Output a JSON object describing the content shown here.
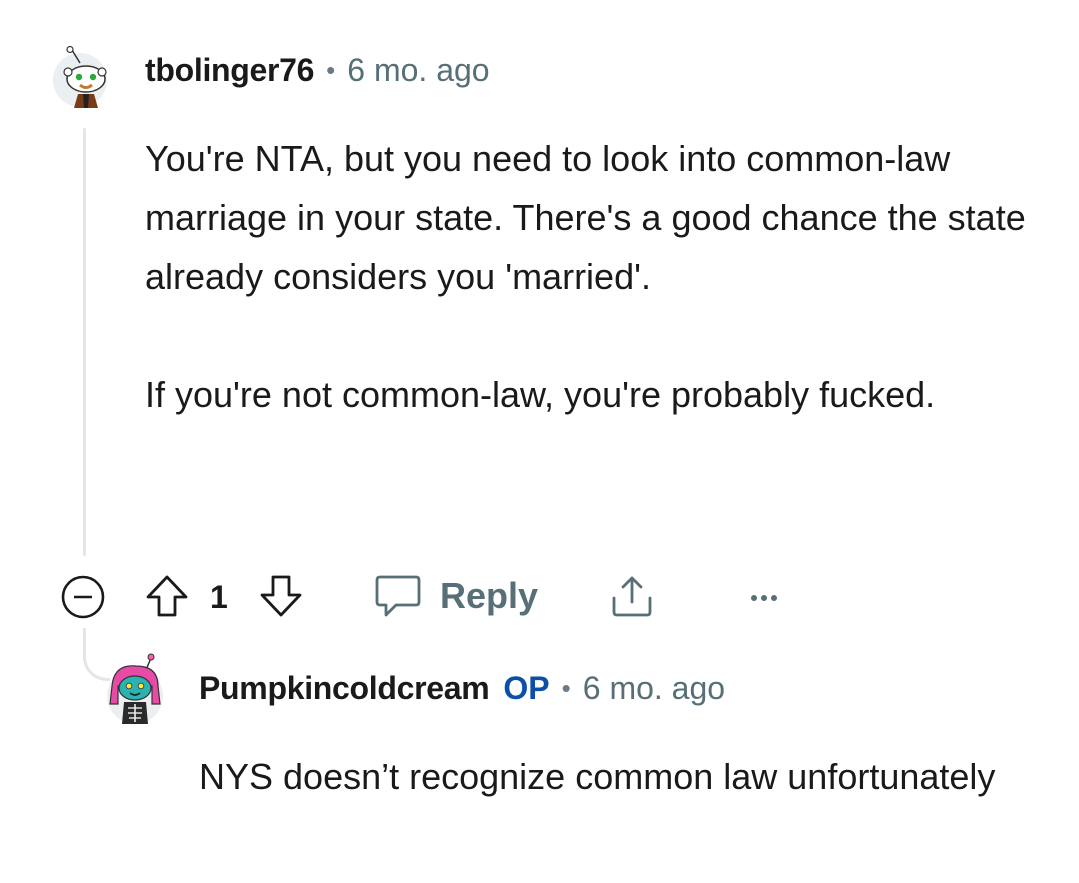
{
  "comment": {
    "username": "tbolinger76",
    "separator": "•",
    "time": "6 mo. ago",
    "paragraphs": [
      "You're NTA, but you need to look into common-law marriage in your state. There's a good chance the state already considers you 'married'.",
      "If you're not common-law, you're probably fucked."
    ],
    "score": "1",
    "reply_label": "Reply",
    "avatar_icon": "snoo-avatar-icon"
  },
  "reply": {
    "username": "Pumpkincoldcream",
    "op_badge": "OP",
    "separator": "•",
    "time": "6 mo. ago",
    "text": "NYS doesn’t recognize common law unfortunately",
    "avatar_icon": "snoo-avatar-icon"
  },
  "colors": {
    "op_badge": "#0b4fa8",
    "meta_text": "#576f76",
    "thread_line": "#e3e6e8"
  }
}
